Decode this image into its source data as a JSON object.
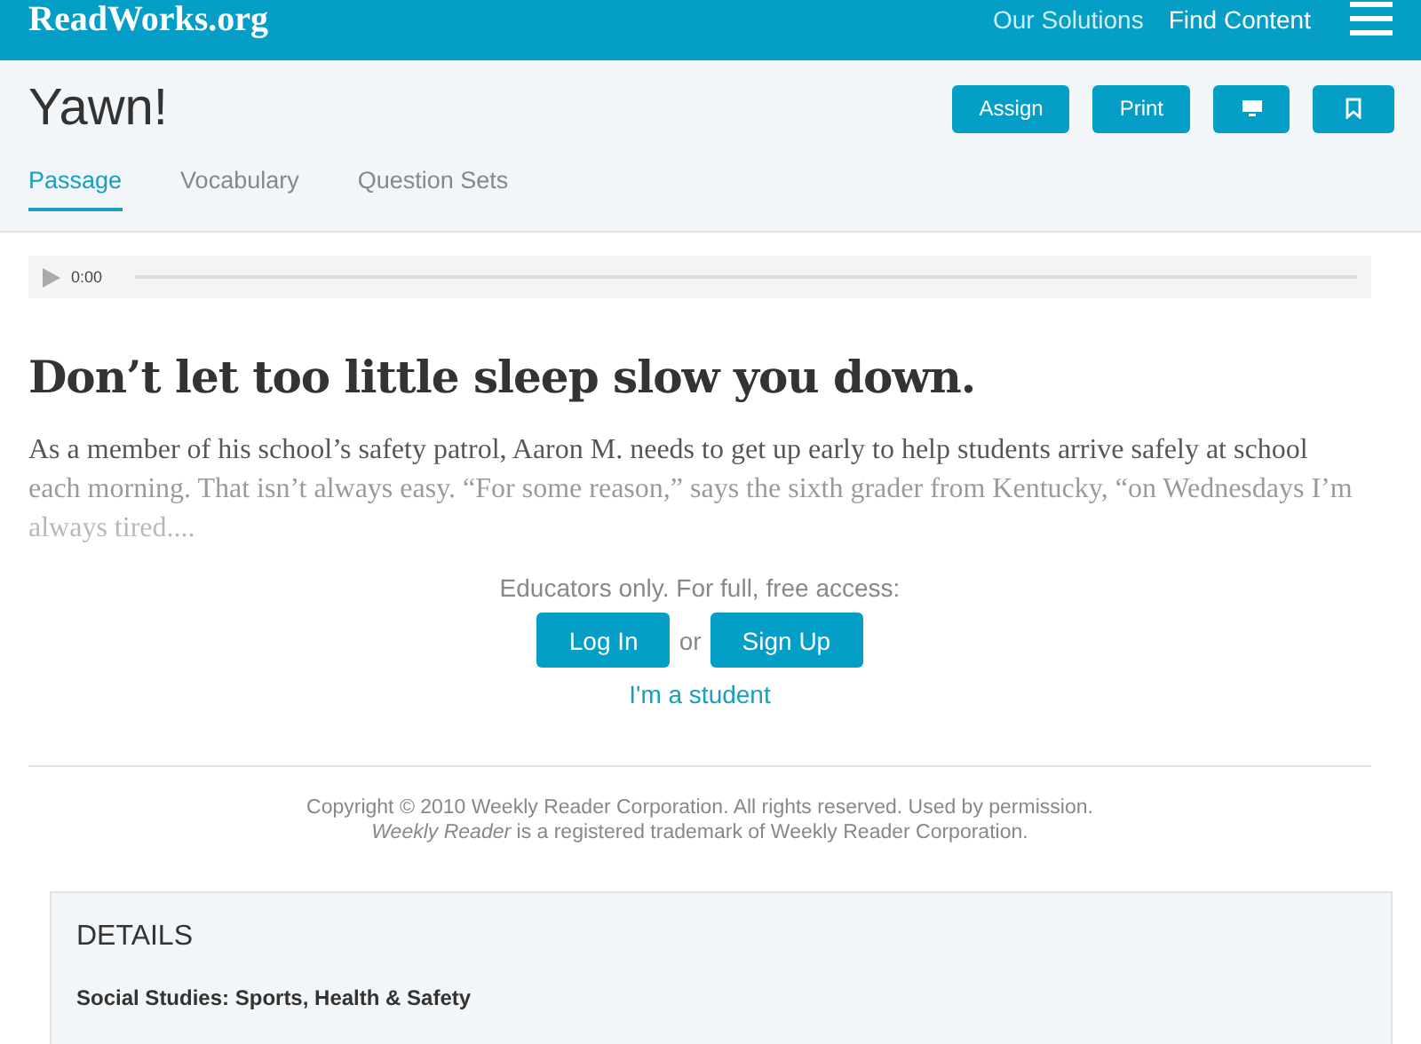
{
  "header": {
    "logo": "ReadWorks.org",
    "nav": [
      "Our Solutions",
      "Find Content"
    ]
  },
  "title": "Yawn!",
  "actions": [
    {
      "kind": "text",
      "label": "Assign"
    },
    {
      "kind": "text",
      "label": "Print"
    },
    {
      "kind": "monitor"
    },
    {
      "kind": "bookmark"
    }
  ],
  "tabs": [
    {
      "label": "Passage",
      "selected": true
    },
    {
      "label": "Vocabulary",
      "selected": false
    },
    {
      "label": "Question Sets",
      "selected": false
    }
  ],
  "audio": {
    "time": "0:00"
  },
  "headline": "Don’t let too little sleep slow you down.",
  "excerpt": "As a member of his school’s safety patrol, Aaron M. needs to get up early to help students arrive safely at school each morning. That isn’t always easy. “For some reason,” says the sixth grader from Kentucky, “on Wednesdays I’m always tired....",
  "access": {
    "prompt": "Educators only. For full, free access:",
    "login": "Log In",
    "or": "or",
    "signup": "Sign Up",
    "student": "I'm a student"
  },
  "copyright": [
    "Copyright © 2010 Weekly Reader Corporation. All rights reserved. Used by permission.",
    "*Weekly Reader* is a registered trademark of Weekly Reader Corporation."
  ],
  "details": {
    "heading": "DETAILS",
    "subject": "Social Studies: Sports, Health & Safety"
  }
}
